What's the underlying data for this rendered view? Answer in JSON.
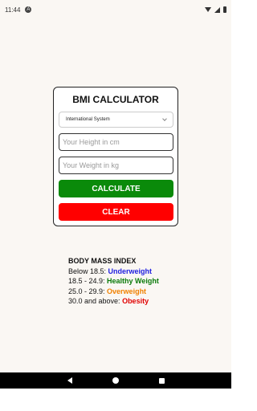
{
  "status_bar": {
    "time": "11:44",
    "notification_icon": "A"
  },
  "app": {
    "title": "BMI CALCULATOR",
    "unit_select": {
      "selected": "International System"
    },
    "height_input": {
      "placeholder": "Your Height in cm",
      "value": ""
    },
    "weight_input": {
      "placeholder": "Your Weight in kg",
      "value": ""
    },
    "calculate_label": "CALCULATE",
    "clear_label": "CLEAR",
    "colors": {
      "calculate": "#0a8a0a",
      "clear": "#ff0000"
    }
  },
  "bmi_index": {
    "heading": "BODY MASS INDEX",
    "rows": [
      {
        "range": "Below 18.5: ",
        "category": "Underweight",
        "color": "#2020e0"
      },
      {
        "range": "18.5 - 24.9: ",
        "category": "Healthy Weight",
        "color": "#0a7a0a"
      },
      {
        "range": "25.0 - 29.9: ",
        "category": "Overweight",
        "color": "#f08000"
      },
      {
        "range": "30.0 and above: ",
        "category": "Obesity",
        "color": "#e00000"
      }
    ]
  },
  "nav_bar": {
    "icons": [
      "back-icon",
      "home-icon",
      "recents-icon"
    ]
  }
}
